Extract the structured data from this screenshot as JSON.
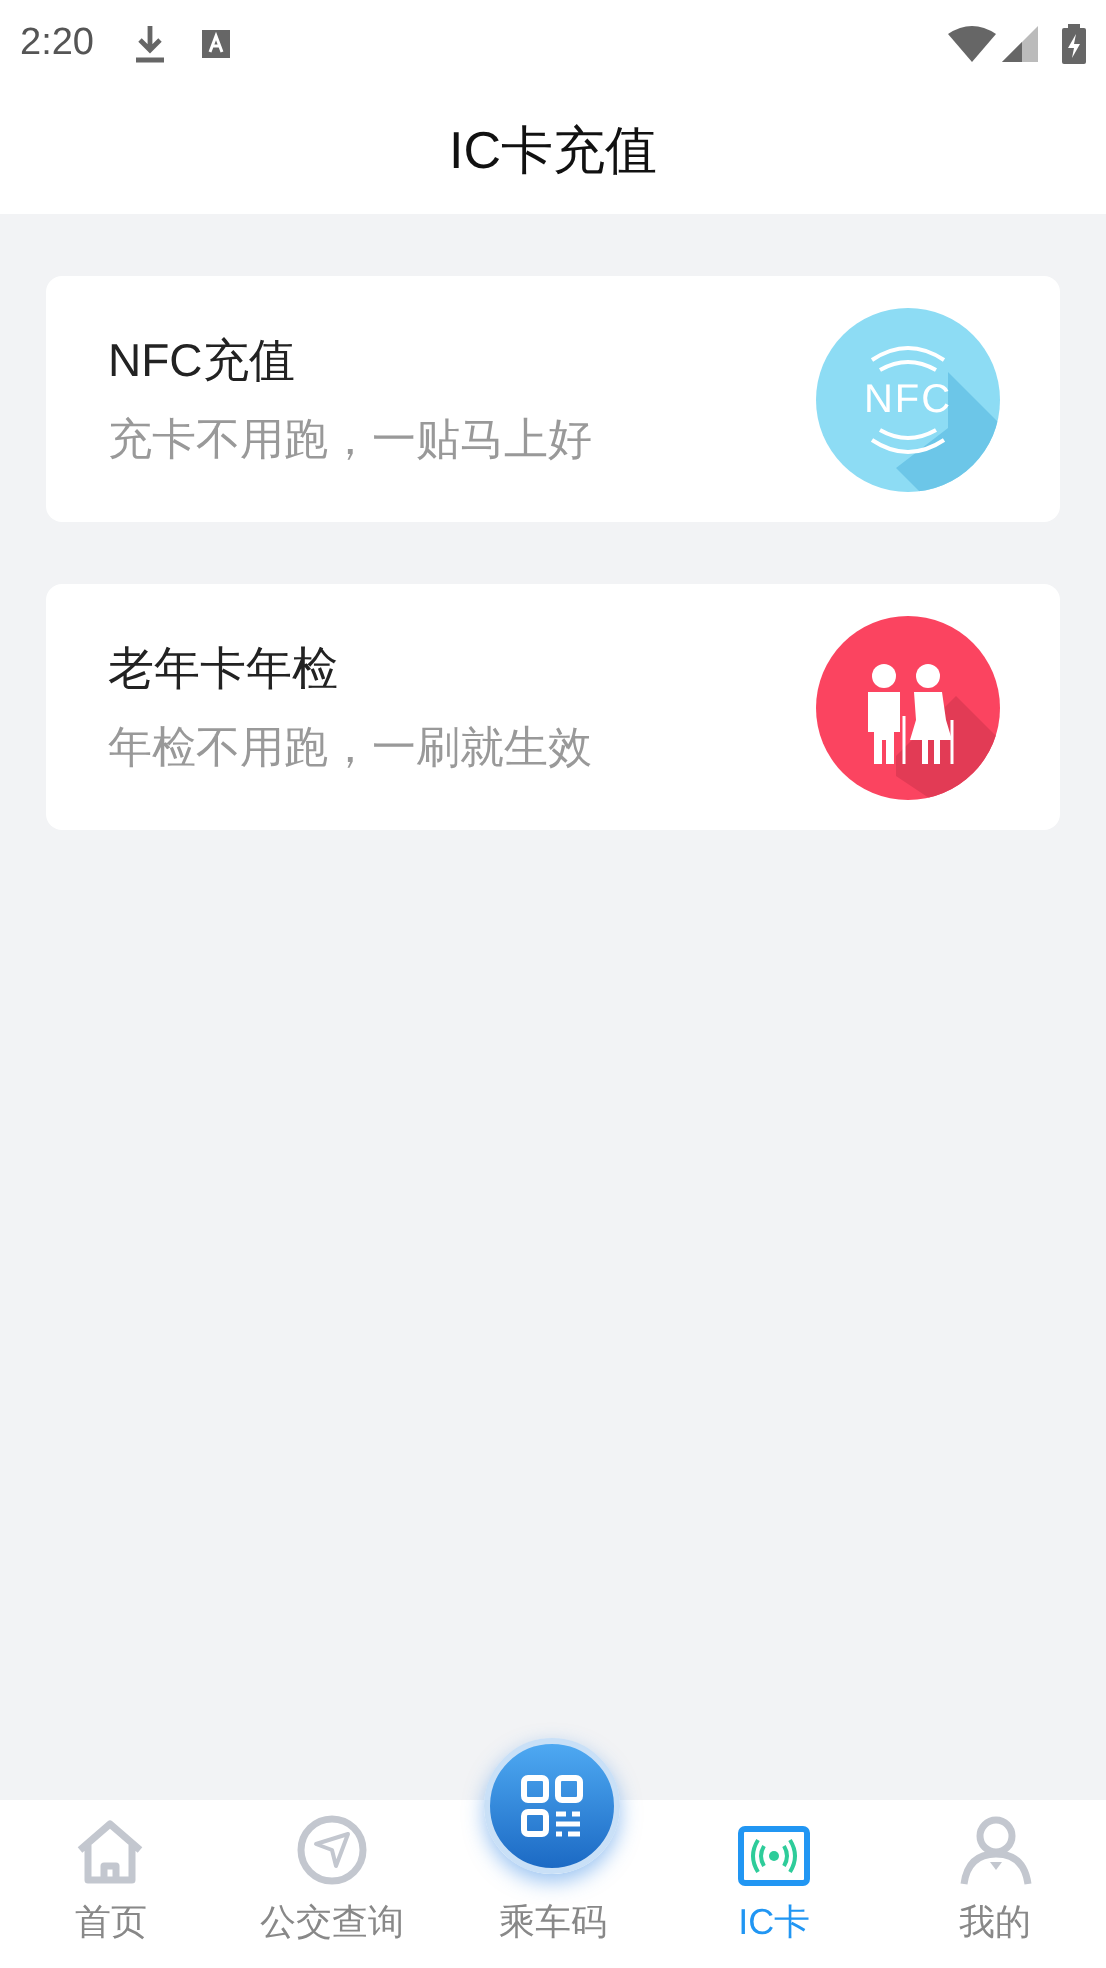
{
  "status_bar": {
    "time": "2:20"
  },
  "header": {
    "title": "IC卡充值"
  },
  "cards": [
    {
      "kind": "nfc",
      "title": "NFC充值",
      "subtitle": "充卡不用跑，一贴马上好",
      "icon_text": "NFC"
    },
    {
      "kind": "elderly",
      "title": "老年卡年检",
      "subtitle": "年检不用跑，一刷就生效"
    }
  ],
  "tabs": [
    {
      "kind": "home",
      "label": "首页",
      "selected": false
    },
    {
      "kind": "bus",
      "label": "公交查询",
      "selected": false
    },
    {
      "kind": "qr",
      "label": "乘车码",
      "selected": false
    },
    {
      "kind": "card",
      "label": "IC卡",
      "selected": true
    },
    {
      "kind": "user",
      "label": "我的",
      "selected": false
    }
  ]
}
